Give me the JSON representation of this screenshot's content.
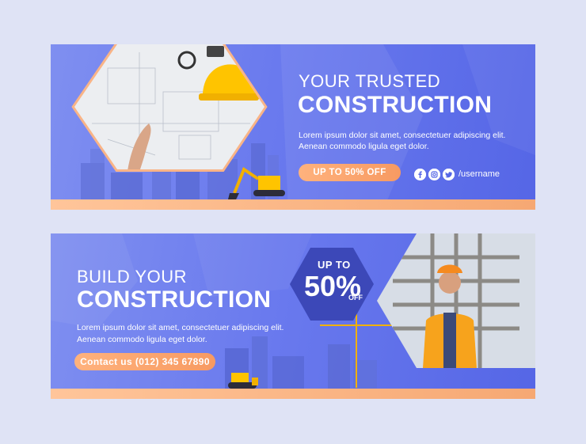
{
  "banner_top": {
    "headline_light": "YOUR TRUSTED",
    "headline_bold": "CONSTRUCTION",
    "body_line1": "Lorem ipsum dolor sit amet, consectetuer adipiscing elit.",
    "body_line2": "Aenean commodo ligula eget dolor.",
    "discount_label": "UP TO 50% OFF",
    "social_icons": [
      "facebook-icon",
      "instagram-icon",
      "twitter-icon"
    ],
    "username": "/username"
  },
  "banner_bottom": {
    "headline_light": "BUILD YOUR",
    "headline_bold": "CONSTRUCTION",
    "body_line1": "Lorem ipsum dolor sit amet, consectetuer adipiscing elit.",
    "body_line2": "Aenean commodo ligula eget dolor.",
    "contact_label": "Contact us (012) 345 67890",
    "offer_up_to": "UP TO",
    "offer_percent": "50%",
    "offer_off": "OFF"
  },
  "colors": {
    "page_background": "#dfe3f5",
    "banner_blue": "#6a7aee",
    "hexagon_dark_blue": "#3c48b8",
    "accent_orange": "#f79a62",
    "stripe_peach": "#ffc59a"
  }
}
